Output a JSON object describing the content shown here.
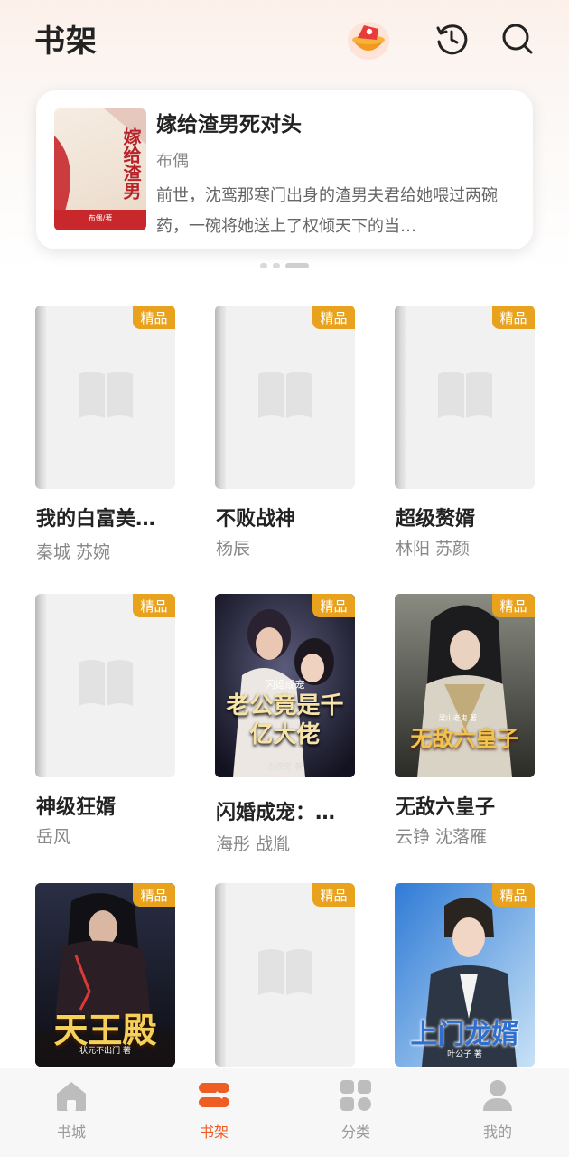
{
  "header": {
    "title": "书架",
    "icons": [
      "red-packet-icon",
      "history-icon",
      "search-icon"
    ]
  },
  "featured": {
    "title": "嫁给渣男死对头",
    "author": "布偶",
    "description": "前世，沈鸾那寒门出身的渣男夫君给她喂过两碗药，一碗将她送上了权倾天下的当…",
    "cover_text": "嫁给渣男",
    "cover_subtext": "布偶/著"
  },
  "carousel": {
    "count": 3,
    "active_index": 2
  },
  "badge_label": "精品",
  "books": [
    {
      "title": "我的白富美…",
      "author": "秦城  苏婉",
      "cover": "placeholder"
    },
    {
      "title": "不败战神",
      "author": "杨辰",
      "cover": "placeholder"
    },
    {
      "title": "超级赘婿",
      "author": "林阳  苏颜",
      "cover": "placeholder"
    },
    {
      "title": "神级狂婿",
      "author": "岳风",
      "cover": "placeholder"
    },
    {
      "title": "闪婚成宠：…",
      "author": "海彤  战胤",
      "cover": "art",
      "cover_text": "老公竟是千亿大佬",
      "cover_small": "闪婚成宠",
      "cover_author": "古茂芽 著"
    },
    {
      "title": "无敌六皇子",
      "author": "云铮  沈落雁",
      "cover": "art",
      "cover_text": "无敌六皇子",
      "cover_author": "梁山老鬼 著"
    },
    {
      "title": "",
      "author": "",
      "cover": "art",
      "cover_text": "天王殿",
      "cover_author": "状元不出门 著"
    },
    {
      "title": "",
      "author": "",
      "cover": "placeholder"
    },
    {
      "title": "",
      "author": "",
      "cover": "art",
      "cover_text": "上门龙婿",
      "cover_author": "叶公子 著"
    }
  ],
  "nav": [
    {
      "label": "书城",
      "icon": "home-icon",
      "active": false
    },
    {
      "label": "书架",
      "icon": "bookshelf-icon",
      "active": true
    },
    {
      "label": "分类",
      "icon": "category-icon",
      "active": false
    },
    {
      "label": "我的",
      "icon": "profile-icon",
      "active": false
    }
  ],
  "colors": {
    "accent": "#ee5d24",
    "badge": "#e9a21d"
  }
}
